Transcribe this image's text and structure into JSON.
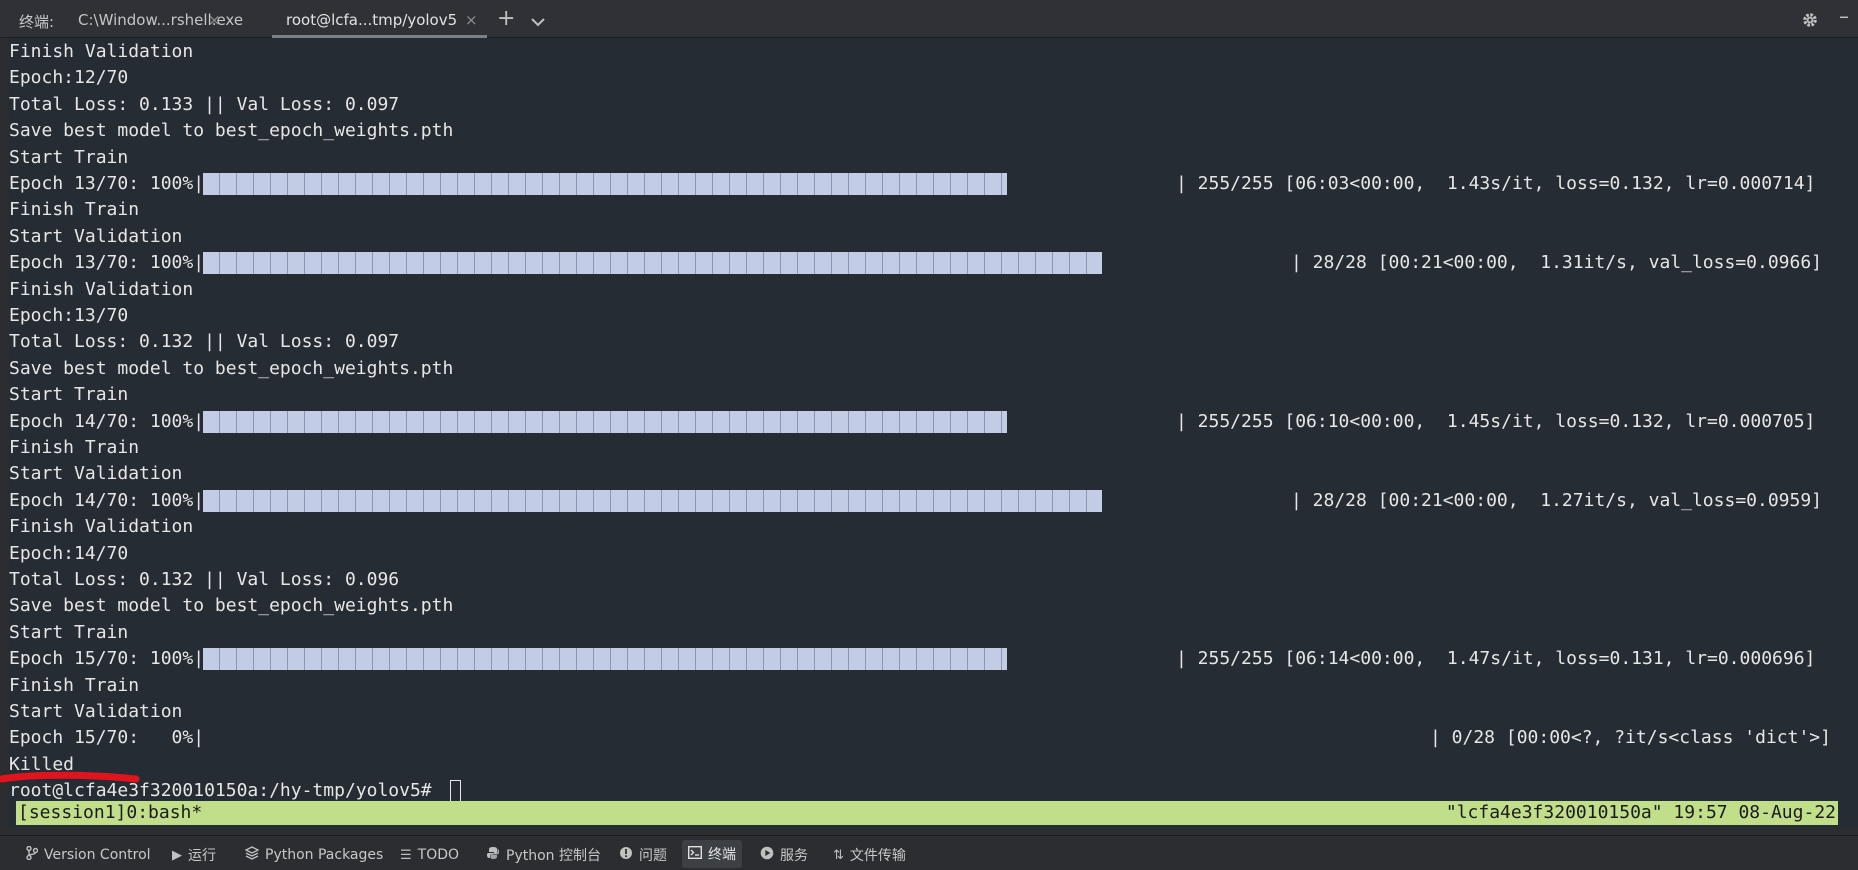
{
  "tabbar": {
    "label": "终端:",
    "tabs": [
      {
        "label": "C:\\Window...rshell.exe",
        "close": "×"
      },
      {
        "label": "root@lcfa...tmp/yolov5",
        "close": "×"
      }
    ],
    "add_icon": "+",
    "dropdown_icon": "chevron-down-icon",
    "settings_icon": "gear-icon",
    "minimize_icon": "–"
  },
  "terminal": {
    "lines": [
      "Finish Validation",
      "Epoch:12/70",
      "Total Loss: 0.133 || Val Loss: 0.097",
      "Save best model to best_epoch_weights.pth",
      "Start Train",
      "Epoch 13/70: 100%|",
      "Finish Train",
      "Start Validation",
      "Epoch 13/70: 100%|",
      "Finish Validation",
      "Epoch:13/70",
      "Total Loss: 0.132 || Val Loss: 0.097",
      "Save best model to best_epoch_weights.pth",
      "Start Train",
      "Epoch 14/70: 100%|",
      "Finish Train",
      "Start Validation",
      "Epoch 14/70: 100%|",
      "Finish Validation",
      "Epoch:14/70",
      "Total Loss: 0.132 || Val Loss: 0.096",
      "Save best model to best_epoch_weights.pth",
      "Start Train",
      "Epoch 15/70: 100%|",
      "Finish Train",
      "Start Validation",
      "Epoch 15/70:   0%|",
      "Killed",
      "root@lcfa4e3f320010150a:/hy-tmp/yolov5#"
    ],
    "progress": [
      {
        "line": 5,
        "label": "Epoch 13/70: 100%|",
        "tail": "| 255/255 [06:03<00:00,  1.43s/it, loss=0.132, lr=0.000714]",
        "fraction": 1.0,
        "kind": "train"
      },
      {
        "line": 8,
        "label": "Epoch 13/70: 100%|",
        "tail": "| 28/28 [00:21<00:00,  1.31it/s, val_loss=0.0966]",
        "fraction": 1.0,
        "kind": "val"
      },
      {
        "line": 14,
        "label": "Epoch 14/70: 100%|",
        "tail": "| 255/255 [06:10<00:00,  1.45s/it, loss=0.132, lr=0.000705]",
        "fraction": 1.0,
        "kind": "train"
      },
      {
        "line": 17,
        "label": "Epoch 14/70: 100%|",
        "tail": "| 28/28 [00:21<00:00,  1.27it/s, val_loss=0.0959]",
        "fraction": 1.0,
        "kind": "val"
      },
      {
        "line": 23,
        "label": "Epoch 15/70: 100%|",
        "tail": "| 255/255 [06:14<00:00,  1.47s/it, loss=0.131, lr=0.000696]",
        "fraction": 1.0,
        "kind": "train"
      },
      {
        "line": 26,
        "label": "Epoch 15/70:   0%|",
        "tail": "| 0/28 [00:00<?, ?it/s<class 'dict'>]",
        "fraction": 0.0,
        "kind": "val"
      }
    ],
    "colors": {
      "background": "#262c33",
      "text": "#e6e6e6",
      "bar": "#c2cde5",
      "annotation": "#e0141d"
    }
  },
  "tmux": {
    "left": "[session1]0:bash*",
    "right": "\"lcfa4e3f320010150a\" 19:57 08-Aug-22",
    "color": "#c1de8b"
  },
  "bottombar": {
    "items": [
      {
        "label": "Version Control",
        "icon": "branch-icon"
      },
      {
        "label": "运行",
        "icon": "play-icon"
      },
      {
        "label": "Python Packages",
        "icon": "layers-icon"
      },
      {
        "label": "TODO",
        "icon": "list-icon"
      },
      {
        "label": "Python 控制台",
        "icon": "python-icon"
      },
      {
        "label": "问题",
        "icon": "info-icon"
      },
      {
        "label": "终端",
        "icon": "terminal-icon",
        "active": true
      },
      {
        "label": "服务",
        "icon": "services-icon"
      },
      {
        "label": "文件传输",
        "icon": "transfer-icon"
      }
    ]
  }
}
